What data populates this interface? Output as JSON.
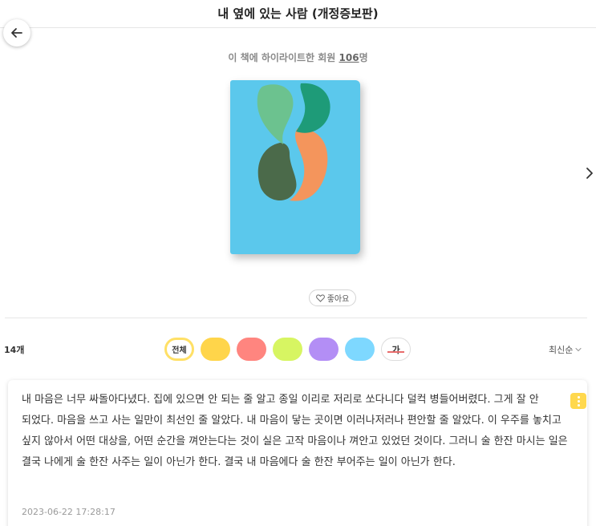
{
  "header": {
    "title": "내 옆에 있는 사람 (개정증보판)"
  },
  "book": {
    "highlight_prefix": "이 책에 하이라이트한 회원 ",
    "highlight_count": "106",
    "highlight_suffix": "명",
    "cover_colors": {
      "background": "#5bc8ec",
      "green_light": "#6cc28f",
      "green_dark": "#1e9b78",
      "olive": "#4b6a4a",
      "orange": "#f4955c"
    }
  },
  "like": {
    "label": "좋아요"
  },
  "list": {
    "count_label": "14개",
    "sort_label": "최신순"
  },
  "filters": {
    "all_label": "전체",
    "text_label": "가",
    "colors": [
      "#ffd54a",
      "#ff857f",
      "#d7f562",
      "#b38ef5",
      "#7ed8ff"
    ]
  },
  "highlight_card": {
    "text": "내 마음은 너무 싸돌아다녔다. 집에 있으면 안 되는 줄 알고 종일 이리로 저리로 쏘다니다 덜컥 병들어버렸다. 그게 잘 안 되었다. 마음을 쓰고 사는 일만이 최선인 줄 알았다. 내 마음이 닿는 곳이면 이러나저러나 편안할 줄 알았다. 이 우주를 놓치고 싶지 않아서 어떤 대상을, 어떤 순간을 껴안는다는 것이 실은 고작 마음이나 껴안고 있었던 것이다. 그러니 술 한잔 마시는 일은 결국 나에게 술 한잔 사주는 일이 아닌가 한다. 결국 내 마음에다 술 한잔 부어주는 일이 아닌가 한다.",
    "date": "2023-06-22 17:28:17"
  }
}
